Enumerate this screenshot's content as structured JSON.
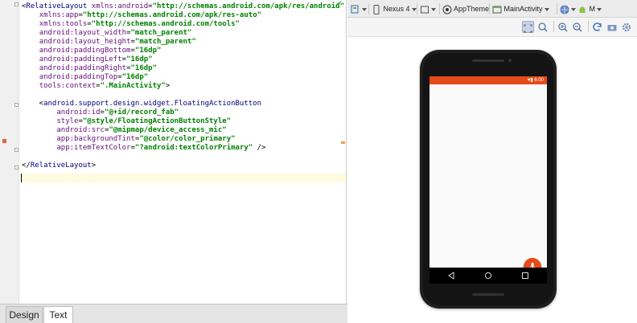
{
  "editor": {
    "lines": [
      {
        "parts": [
          [
            "p",
            "<"
          ],
          [
            "tag",
            "RelativeLayout"
          ],
          [
            "p",
            " "
          ],
          [
            "attr",
            "xmlns:android"
          ],
          [
            "p",
            "="
          ],
          [
            "str",
            "\"http://schemas.android.com/apk/res/android\""
          ]
        ]
      },
      {
        "parts": [
          [
            "p",
            "    "
          ],
          [
            "attr",
            "xmlns:app"
          ],
          [
            "p",
            "="
          ],
          [
            "str",
            "\"http://schemas.android.com/apk/res-auto\""
          ]
        ]
      },
      {
        "parts": [
          [
            "p",
            "    "
          ],
          [
            "attr",
            "xmlns:tools"
          ],
          [
            "p",
            "="
          ],
          [
            "str",
            "\"http://schemas.android.com/tools\""
          ]
        ]
      },
      {
        "parts": [
          [
            "p",
            "    "
          ],
          [
            "attr",
            "android:layout_width"
          ],
          [
            "p",
            "="
          ],
          [
            "str",
            "\"match_parent\""
          ]
        ]
      },
      {
        "parts": [
          [
            "p",
            "    "
          ],
          [
            "attr",
            "android:layout_height"
          ],
          [
            "p",
            "="
          ],
          [
            "str",
            "\"match_parent\""
          ]
        ]
      },
      {
        "parts": [
          [
            "p",
            "    "
          ],
          [
            "attr",
            "android:paddingBottom"
          ],
          [
            "p",
            "="
          ],
          [
            "str",
            "\"16dp\""
          ]
        ]
      },
      {
        "parts": [
          [
            "p",
            "    "
          ],
          [
            "attr",
            "android:paddingLeft"
          ],
          [
            "p",
            "="
          ],
          [
            "str",
            "\"16dp\""
          ]
        ]
      },
      {
        "parts": [
          [
            "p",
            "    "
          ],
          [
            "attr",
            "android:paddingRight"
          ],
          [
            "p",
            "="
          ],
          [
            "str",
            "\"16dp\""
          ]
        ]
      },
      {
        "parts": [
          [
            "p",
            "    "
          ],
          [
            "attr",
            "android:paddingTop"
          ],
          [
            "p",
            "="
          ],
          [
            "str",
            "\"16dp\""
          ]
        ]
      },
      {
        "parts": [
          [
            "p",
            "    "
          ],
          [
            "attr",
            "tools:context"
          ],
          [
            "p",
            "="
          ],
          [
            "str",
            "\".MainActivity\""
          ],
          [
            "p",
            ">"
          ]
        ]
      },
      {
        "parts": []
      },
      {
        "parts": [
          [
            "p",
            "    <"
          ],
          [
            "tag",
            "android.support.design.widget.FloatingActionButton"
          ]
        ]
      },
      {
        "parts": [
          [
            "p",
            "        "
          ],
          [
            "attr",
            "android:id"
          ],
          [
            "p",
            "="
          ],
          [
            "str",
            "\"@+id/record_fab\""
          ]
        ]
      },
      {
        "parts": [
          [
            "p",
            "        "
          ],
          [
            "attr",
            "style"
          ],
          [
            "p",
            "="
          ],
          [
            "str",
            "\"@style/FloatingActionButtonStyle\""
          ]
        ]
      },
      {
        "parts": [
          [
            "p",
            "        "
          ],
          [
            "attr",
            "android:src"
          ],
          [
            "p",
            "="
          ],
          [
            "str",
            "\"@mipmap/device_access_mic\""
          ]
        ]
      },
      {
        "parts": [
          [
            "p",
            "        "
          ],
          [
            "attr",
            "app:backgroundTint"
          ],
          [
            "p",
            "="
          ],
          [
            "str",
            "\"@color/color_primary\""
          ]
        ]
      },
      {
        "parts": [
          [
            "p",
            "        "
          ],
          [
            "attr",
            "app:itemTextColor"
          ],
          [
            "p",
            "="
          ],
          [
            "str",
            "\"?android:textColorPrimary\""
          ],
          [
            "p",
            " />"
          ]
        ]
      },
      {
        "parts": []
      },
      {
        "parts": [
          [
            "p",
            "</"
          ],
          [
            "tag",
            "RelativeLayout"
          ],
          [
            "p",
            ">"
          ]
        ]
      },
      {
        "parts": []
      }
    ]
  },
  "bottom_tabs": {
    "design": "Design",
    "text": "Text"
  },
  "toolbar": {
    "device": "Nexus 4",
    "theme": "AppTheme",
    "activity": "MainActivity",
    "api": "M"
  },
  "phone": {
    "status_text": "♥▮ 6:00"
  },
  "colors": {
    "primary": "#e64a19",
    "tag": "#000080",
    "attr": "#660e7a",
    "string": "#008000"
  }
}
